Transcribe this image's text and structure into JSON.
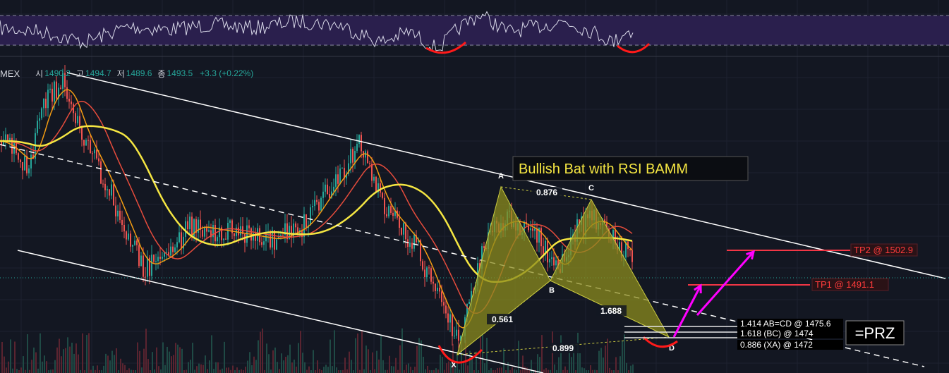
{
  "header": {
    "symbol": "MEX",
    "open_label": "시",
    "open_value": "1490.2",
    "high_label": "고",
    "high_value": "1494.7",
    "low_label": "저",
    "low_value": "1489.6",
    "close_label": "종",
    "close_value": "1493.5",
    "change": "+3.3 (+0.22%)"
  },
  "colors": {
    "background": "#131722",
    "rsi_band": "#2a1f4d",
    "bull": "#26a69a",
    "bear": "#ef5350",
    "ma_orange": "#f39c12",
    "ma_red": "#e74c3c",
    "ma_yellow": "#f5e642",
    "harmonic_fill": "#8c8c1e",
    "arrow": "#ff00ff",
    "annotation_red": "#ff1a1a",
    "target_red": "#f23645"
  },
  "chart_data": {
    "type": "candlestick",
    "title": "Bullish Bat with RSI BAMM",
    "pattern_points": [
      {
        "label": "X"
      },
      {
        "label": "A"
      },
      {
        "label": "B"
      },
      {
        "label": "C"
      },
      {
        "label": "D"
      }
    ],
    "ratios": [
      "0.876",
      "0.561",
      "1.688",
      "0.899"
    ],
    "targets": [
      {
        "label": "TP2 @ 1502.9",
        "price": 1502.9
      },
      {
        "label": "TP1 @ 1491.1",
        "price": 1491.1
      }
    ],
    "prz": {
      "label": "=PRZ",
      "levels": [
        {
          "label": "1.414 AB=CD @ 1475.6",
          "price": 1475.6
        },
        {
          "label": "1.618 (BC) @ 1474",
          "price": 1474
        },
        {
          "label": "0.886 (XA) @ 1472",
          "price": 1472
        }
      ]
    },
    "indicators": [
      "RSI",
      "Volume",
      "Moving Averages"
    ]
  }
}
